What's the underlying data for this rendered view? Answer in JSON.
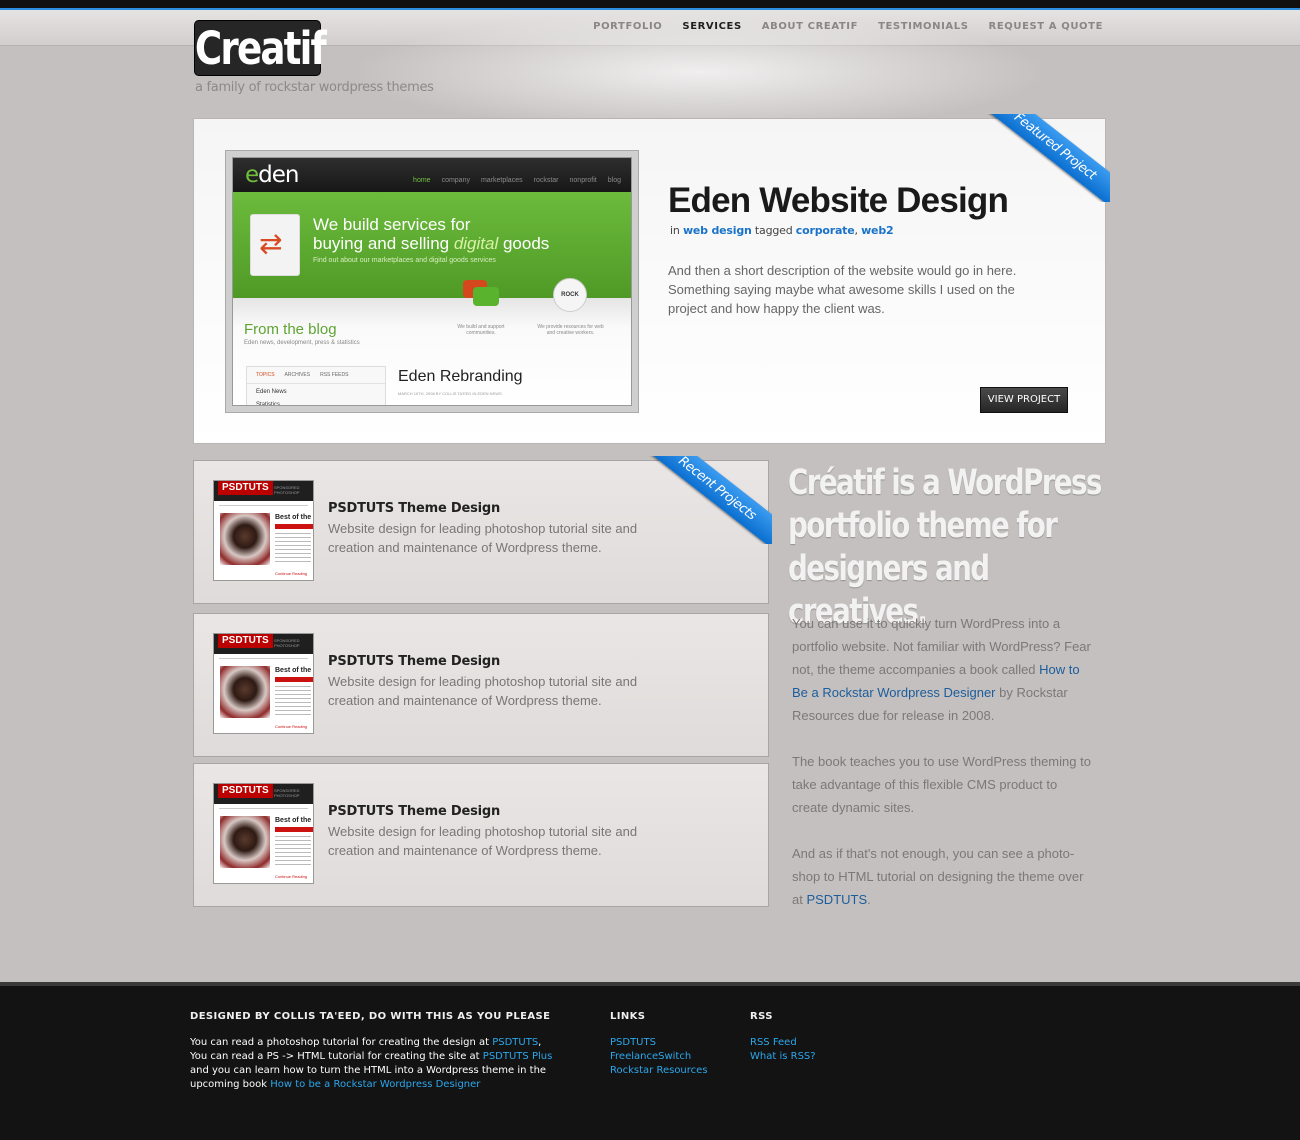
{
  "brand": {
    "logo_text": "Creatif",
    "tagline": "a family of rockstar wordpress themes"
  },
  "nav": {
    "items": [
      {
        "label": "PORTFOLIO",
        "active": false
      },
      {
        "label": "SERVICES",
        "active": true
      },
      {
        "label": "ABOUT CREATIF",
        "active": false
      },
      {
        "label": "TESTIMONIALS",
        "active": false
      },
      {
        "label": "REQUEST A QUOTE",
        "active": false
      }
    ]
  },
  "featured": {
    "ribbon": "Featured Project",
    "title": "Eden Website Design",
    "meta_in": "in",
    "category": "web design",
    "meta_tagged": "tagged",
    "tag1": "corporate",
    "tag_sep": ",",
    "tag2": "web2",
    "description": "And then a short description of the website would go in here. Something saying maybe what awesome skills I used on the project and how happy the client was.",
    "button": "VIEW PROJECT",
    "mockup": {
      "brand_e": "e",
      "brand_rest": "den",
      "nav": [
        "home",
        "company",
        "marketplaces",
        "rockstar",
        "nonprofit",
        "blog"
      ],
      "hero_line1": "We build services for",
      "hero_line2a": "buying and selling ",
      "hero_line2b": "digital",
      "hero_line2c": " goods",
      "hero_sub": "Find out about our marketplaces and digital goods services",
      "blog_title": "From the blog",
      "blog_sub": "Eden news, development, press & statistics",
      "rock": "ROCK",
      "cap1": "We build and support communities.",
      "cap2": "We provide resources for web and creative workers.",
      "tabs": [
        "TOPICS",
        "ARCHIVES",
        "RSS FEEDS"
      ],
      "rows": [
        "Eden News",
        "Statistics"
      ],
      "post_title": "Eden Rebranding",
      "post_meta": "MARCH 16TH, 2008 BY COLLIS TA'EED IN EDEN NEWS"
    }
  },
  "recent": {
    "ribbon": "Recent Projects",
    "items": [
      {
        "title": "PSDTUTS Theme Design",
        "description": "Website design for leading photoshop tutorial site and creation and maintenance of Wordpress theme.",
        "thumb_logo": "PSDTUTS",
        "thumb_sub": "SPONSORED PHOTOSHOP",
        "thumb_heading": "Best of the",
        "thumb_footer": "Continue Reading"
      },
      {
        "title": "PSDTUTS Theme Design",
        "description": "Website design for leading photoshop tutorial site and creation and maintenance of Wordpress theme.",
        "thumb_logo": "PSDTUTS",
        "thumb_sub": "SPONSORED PHOTOSHOP",
        "thumb_heading": "Best of the",
        "thumb_footer": "Continue Reading"
      },
      {
        "title": "PSDTUTS Theme Design",
        "description": "Website design for leading photoshop tutorial site and creation and maintenance of Wordpress theme.",
        "thumb_logo": "PSDTUTS",
        "thumb_sub": "SPONSORED PHOTOSHOP",
        "thumb_heading": "Best of the",
        "thumb_footer": "Continue Reading"
      }
    ]
  },
  "promo": {
    "headline_1": "Créatif is a WordPress",
    "headline_2": "portfolio theme for",
    "headline_3": "designers and creatives.",
    "p1_a": "You can use it to quickly turn WordPress into a portfolio website.  Not familiar with WordPress? Fear not, the theme accompanies a book called ",
    "p1_link": "How to Be a Rockstar Wordpress Designer",
    "p1_b": " by Rockstar Resources due for release in 2008.",
    "p2": "The book teaches you to use WordPress theming to take advantage of this flexible CMS product to create dynamic sites.",
    "p3_a": "And as if that's not enough, you can see a photo-shop to HTML tutorial on designing the theme over at ",
    "p3_link": "PSDTUTS",
    "p3_b": "."
  },
  "footer": {
    "col1_heading": "DESIGNED BY COLLIS TA'EED, DO WITH THIS AS YOU PLEASE",
    "l1_a": "You can read a photoshop tutorial for creating the design at ",
    "l1_link": "PSDTUTS",
    "l1_b": ",",
    "l2_a": "You can read a PS -> HTML tutorial for creating the site at ",
    "l2_link": "PSDTUTS Plus",
    "l3": "and you can learn how to turn the HTML into a Wordpress theme in the",
    "l4_a": "upcoming book ",
    "l4_link": "How to be a Rockstar Wordpress Designer",
    "links_heading": "LINKS",
    "links": [
      "PSDTUTS",
      "FreelanceSwitch",
      "Rockstar Resources"
    ],
    "rss_heading": "RSS",
    "rss": [
      "RSS Feed",
      "What is RSS?"
    ]
  },
  "colors": {
    "accent_blue": "#1a73c8",
    "ribbon_blue": "#0b6fd0",
    "footer_bg": "#131313",
    "page_bg": "#c4c0bf"
  }
}
